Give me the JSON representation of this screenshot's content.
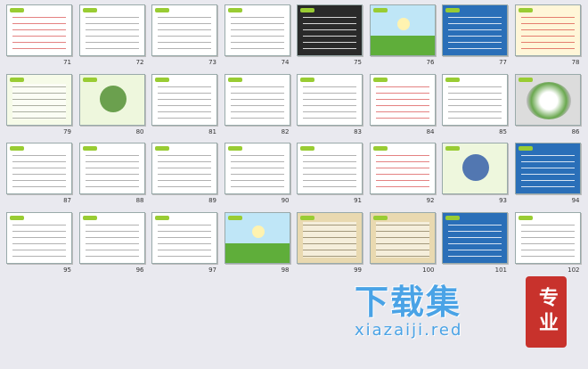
{
  "slides": [
    {
      "num": "71",
      "bg": "#ffffff",
      "accent": "#c00000",
      "style": "text-red"
    },
    {
      "num": "72",
      "bg": "#ffffff",
      "accent": "#333333",
      "style": "text"
    },
    {
      "num": "73",
      "bg": "#ffffff",
      "accent": "#333333",
      "style": "text-box"
    },
    {
      "num": "74",
      "bg": "#ffffff",
      "accent": "#2060b0",
      "style": "blue-bold"
    },
    {
      "num": "75",
      "bg": "#2a2a2a",
      "accent": "#ffffff",
      "style": "dark-text"
    },
    {
      "num": "76",
      "bg": "#bfe6f7",
      "accent": "#5fae3a",
      "style": "meadow"
    },
    {
      "num": "77",
      "bg": "#2a6fb8",
      "accent": "#ffffff",
      "style": "blue-text"
    },
    {
      "num": "78",
      "bg": "#fff6d8",
      "accent": "#c00000",
      "style": "cover-red"
    },
    {
      "num": "79",
      "bg": "#f6fbe8",
      "accent": "#444444",
      "style": "text"
    },
    {
      "num": "80",
      "bg": "#eef7dd",
      "accent": "#4a8a2a",
      "style": "cricket"
    },
    {
      "num": "81",
      "bg": "#ffffff",
      "accent": "#2a56a6",
      "style": "diagram"
    },
    {
      "num": "82",
      "bg": "#ffffff",
      "accent": "#3a7fbf",
      "style": "text-box"
    },
    {
      "num": "83",
      "bg": "#ffffff",
      "accent": "#2a56a6",
      "style": "list"
    },
    {
      "num": "84",
      "bg": "#ffffff",
      "accent": "#c00000",
      "style": "text-red"
    },
    {
      "num": "85",
      "bg": "#ffffff",
      "accent": "#333333",
      "style": "text"
    },
    {
      "num": "86",
      "bg": "#dcdcdc",
      "accent": "#6aa84f",
      "style": "photo"
    },
    {
      "num": "87",
      "bg": "#ffffff",
      "accent": "#333333",
      "style": "text"
    },
    {
      "num": "88",
      "bg": "#ffffff",
      "accent": "#333333",
      "style": "text"
    },
    {
      "num": "89",
      "bg": "#ffffff",
      "accent": "#2a56a6",
      "style": "text-box"
    },
    {
      "num": "90",
      "bg": "#ffffff",
      "accent": "#333333",
      "style": "text"
    },
    {
      "num": "91",
      "bg": "#ffffff",
      "accent": "#333333",
      "style": "text"
    },
    {
      "num": "92",
      "bg": "#ffffff",
      "accent": "#c00000",
      "style": "text-red"
    },
    {
      "num": "93",
      "bg": "#eef7dd",
      "accent": "#2a56a6",
      "style": "cartoon"
    },
    {
      "num": "94",
      "bg": "#2a6fb8",
      "accent": "#ffffff",
      "style": "blue-text"
    },
    {
      "num": "95",
      "bg": "#ffffff",
      "accent": "#333333",
      "style": "text"
    },
    {
      "num": "96",
      "bg": "#ffffff",
      "accent": "#333333",
      "style": "text"
    },
    {
      "num": "97",
      "bg": "#ffffff",
      "accent": "#333333",
      "style": "text"
    },
    {
      "num": "98",
      "bg": "#bfe6f7",
      "accent": "#5fae3a",
      "style": "meadow"
    },
    {
      "num": "99",
      "bg": "#e9d9b0",
      "accent": "#333333",
      "style": "text"
    },
    {
      "num": "100",
      "bg": "#e9d9b0",
      "accent": "#333333",
      "style": "text"
    },
    {
      "num": "101",
      "bg": "#2a6fb8",
      "accent": "#ffffff",
      "style": "blue-text"
    },
    {
      "num": "102",
      "bg": "#ffffff",
      "accent": "#333333",
      "style": "photo-text"
    }
  ],
  "watermark": {
    "main": "下载集",
    "sub": "xiazaiji.red",
    "seal": "专业",
    "color": "#4aa3e6",
    "seal_color": "#c8322c"
  }
}
